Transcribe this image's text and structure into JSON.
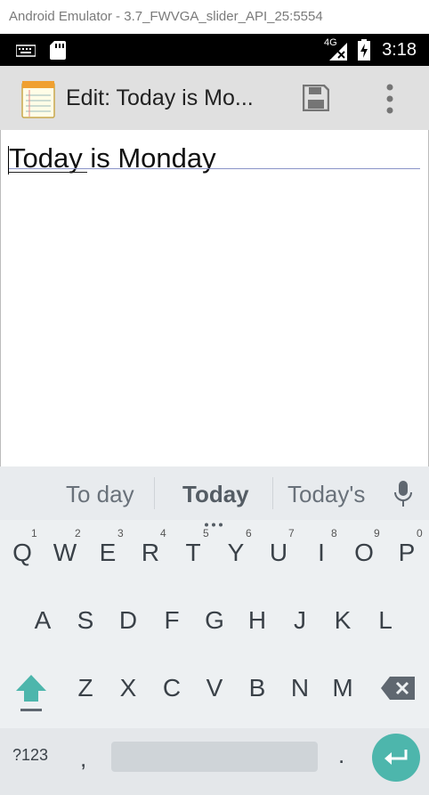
{
  "window": {
    "title": "Android Emulator - 3.7_FWVGA_slider_API_25:5554"
  },
  "status_bar": {
    "network": "4G",
    "time": "3:18"
  },
  "app_bar": {
    "title": "Edit: Today is Mo..."
  },
  "editor": {
    "text": "Today is Monday"
  },
  "keyboard": {
    "suggestions": [
      "To day",
      "Today",
      "Today's"
    ],
    "row1": [
      {
        "k": "Q",
        "h": "1"
      },
      {
        "k": "W",
        "h": "2"
      },
      {
        "k": "E",
        "h": "3"
      },
      {
        "k": "R",
        "h": "4"
      },
      {
        "k": "T",
        "h": "5"
      },
      {
        "k": "Y",
        "h": "6"
      },
      {
        "k": "U",
        "h": "7"
      },
      {
        "k": "I",
        "h": "8"
      },
      {
        "k": "O",
        "h": "9"
      },
      {
        "k": "P",
        "h": "0"
      }
    ],
    "row2": [
      "A",
      "S",
      "D",
      "F",
      "G",
      "H",
      "J",
      "K",
      "L"
    ],
    "row3": [
      "Z",
      "X",
      "C",
      "V",
      "B",
      "N",
      "M"
    ],
    "symbols_label": "?123",
    "comma": ",",
    "period": "."
  },
  "colors": {
    "accent": "#4db6ac",
    "status_bar": "#000000",
    "app_bar": "#e0e0e0"
  },
  "icons": [
    "sd-card-icon",
    "keyboard-icon",
    "signal-icon",
    "battery-icon",
    "notepad-icon",
    "save-icon",
    "overflow-menu-icon",
    "mic-icon",
    "shift-icon",
    "backspace-icon",
    "enter-icon"
  ]
}
